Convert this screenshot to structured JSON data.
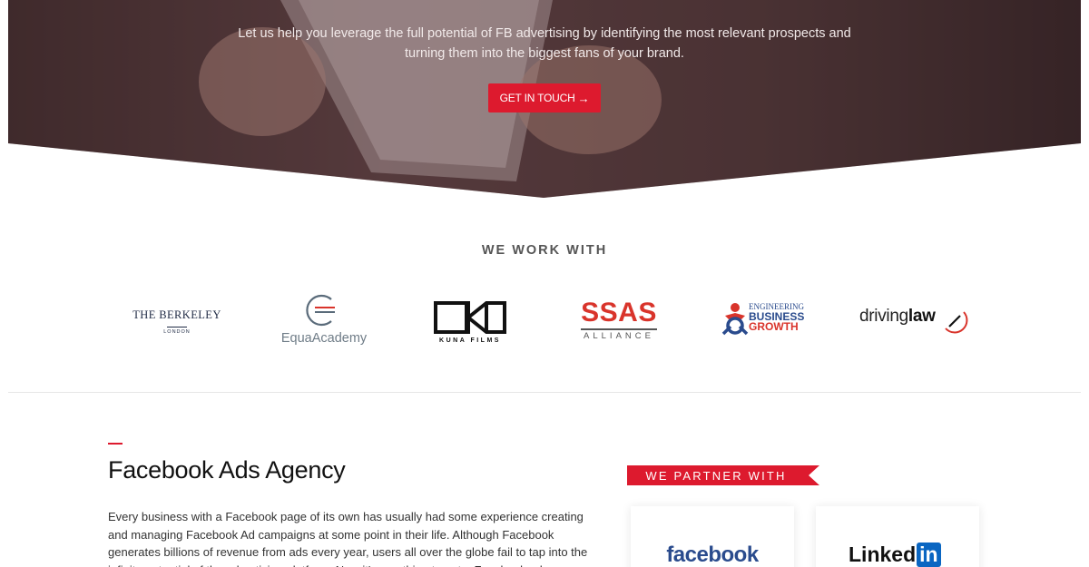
{
  "hero": {
    "line1": "Let us help you leverage the full potential of FB advertising by identifying the most relevant prospects and",
    "line2": "turning them into the biggest fans of your brand.",
    "cta_label": "GET IN TOUCH",
    "cta_icon": "arrow-right-icon"
  },
  "clients": {
    "title": "WE WORK WITH",
    "logos": [
      {
        "name": "THE BERKELEY",
        "sub": "LONDON"
      },
      {
        "name": "EquaAcademy"
      },
      {
        "name": "KUNA FILMS"
      },
      {
        "name": "SSAS",
        "sub": "ALLIANCE"
      },
      {
        "name": "ENGINEERING",
        "name2": "BUSINESS",
        "name3": "GROWTH"
      },
      {
        "name": "driving",
        "name_bold": "law"
      }
    ]
  },
  "agency": {
    "title": "Facebook Ads Agency",
    "body": "Every business with a Facebook page of its own has usually had some experience creating and managing Facebook Ad campaigns at some point in their life. Although Facebook generates billions of revenue from ads every year, users all over the globe fail to tap into the infinite potential of the advertising platform. Now it's one thing to get a Facebook ad"
  },
  "partners": {
    "label": "WE PARTNER WITH",
    "facebook": "facebook",
    "linkedin_a": "Linked",
    "linkedin_b": "in"
  },
  "colors": {
    "accent": "#dd1a2e",
    "facebook_blue": "#2a4b8d",
    "linkedin_blue": "#0a66c2"
  }
}
